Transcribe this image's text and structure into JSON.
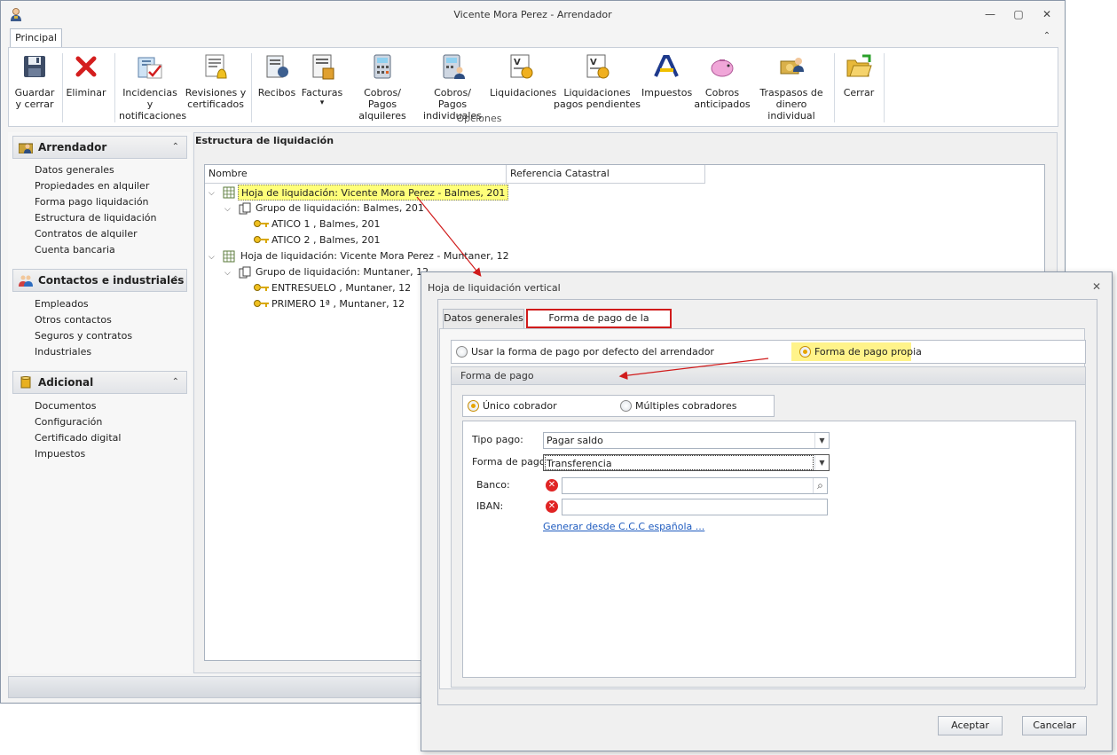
{
  "window": {
    "title": "Vicente Mora Perez - Arrendador",
    "minimize": "—",
    "maximize": "▢",
    "close": "✕"
  },
  "ribbon": {
    "tab": "Principal",
    "collapse": "⌃",
    "group_label": "Opciones",
    "buttons": [
      {
        "label": "Guardar\ny cerrar",
        "icon": "floppy-disk-icon"
      },
      {
        "label": "Eliminar",
        "icon": "red-x-icon"
      },
      {
        "label": "Incidencias y\nnotificaciones",
        "icon": "clipboard-check-icon"
      },
      {
        "label": "Revisiones y\ncertificados",
        "icon": "document-bell-icon"
      },
      {
        "label": "Recibos",
        "icon": "receipt-icon"
      },
      {
        "label": "Facturas",
        "icon": "invoice-icon",
        "dropdown": "▾"
      },
      {
        "label": "Cobros/ Pagos\nalquileres",
        "icon": "calculator-icon"
      },
      {
        "label": "Cobros/ Pagos\nindividuales",
        "icon": "calculator-user-icon"
      },
      {
        "label": "Liquidaciones",
        "icon": "document-v-icon"
      },
      {
        "label": "Liquidaciones\npagos pendientes",
        "icon": "document-v-pending-icon"
      },
      {
        "label": "Impuestos",
        "icon": "tax-agency-icon"
      },
      {
        "label": "Cobros\nanticipados",
        "icon": "piggy-bank-icon"
      },
      {
        "label": "Traspasos de\ndinero individual",
        "icon": "money-transfer-icon"
      },
      {
        "label": "Cerrar",
        "icon": "folder-exit-icon"
      }
    ]
  },
  "nav": {
    "sections": [
      {
        "title": "Arrendador",
        "icon": "landlord-icon",
        "items": [
          "Datos generales",
          "Propiedades en alquiler",
          "Forma pago liquidación",
          "Estructura de liquidación",
          "Contratos de alquiler",
          "Cuenta bancaria"
        ]
      },
      {
        "title": "Contactos e industriales",
        "icon": "contacts-icon",
        "items": [
          "Empleados",
          "Otros contactos",
          "Seguros y contratos",
          "Industriales"
        ]
      },
      {
        "title": "Adicional",
        "icon": "database-icon",
        "items": [
          "Documentos",
          "Configuración",
          "Certificado digital",
          "Impuestos"
        ]
      }
    ],
    "collapse_glyph": "⌃"
  },
  "content": {
    "title": "Estructura de liquidación",
    "columns": [
      "Nombre",
      "Referencia Catastral"
    ],
    "rows": [
      {
        "level": 0,
        "type": "hoja",
        "label": "Hoja de liquidación: Vicente Mora Perez - Balmes, 201",
        "expanded": true,
        "highlighted": true
      },
      {
        "level": 1,
        "type": "grupo",
        "label": "Grupo de liquidación: Balmes, 201",
        "expanded": true
      },
      {
        "level": 2,
        "type": "inmueble",
        "label": "ATICO 1 , Balmes, 201"
      },
      {
        "level": 2,
        "type": "inmueble",
        "label": "ATICO 2 , Balmes, 201"
      },
      {
        "level": 0,
        "type": "hoja",
        "label": "Hoja de liquidación: Vicente Mora Perez - Muntaner, 12",
        "expanded": true
      },
      {
        "level": 1,
        "type": "grupo",
        "label": "Grupo de liquidación: Muntaner, 12",
        "expanded": true
      },
      {
        "level": 2,
        "type": "inmueble",
        "label": "ENTRESUELO , Muntaner, 12"
      },
      {
        "level": 2,
        "type": "inmueble",
        "label": "PRIMERO 1ª , Muntaner, 12"
      }
    ],
    "expand_glyph": "⌵"
  },
  "dialog": {
    "title": "Hoja de liquidación vertical",
    "close": "✕",
    "tabs": [
      "Datos generales",
      "Forma de pago de la liquidación"
    ],
    "active_tab": 1,
    "source_options": {
      "default": "Usar la forma de pago por defecto del arrendador",
      "own": "Forma de pago propia",
      "selected": "own"
    },
    "group_title": "Forma de pago",
    "collector_options": {
      "single": "Único cobrador",
      "multiple": "Múltiples cobradores",
      "selected": "single"
    },
    "fields": {
      "tipo_pago_label": "Tipo pago:",
      "tipo_pago_value": "Pagar saldo",
      "forma_pago_label": "Forma de pago:",
      "forma_pago_value": "Transferencia",
      "banco_label": "Banco:",
      "banco_value": "",
      "iban_label": "IBAN:",
      "iban_value": "",
      "error_glyph": "✕",
      "search_glyph": "⌕",
      "dropdown_glyph": "▼"
    },
    "generate_link": "Generar desde C.C.C española ...",
    "accept": "Aceptar",
    "cancel": "Cancelar"
  },
  "colors": {
    "highlight": "#ffff7a",
    "annotation_red": "#d01b1b",
    "radio_selected": "#e6a400"
  }
}
